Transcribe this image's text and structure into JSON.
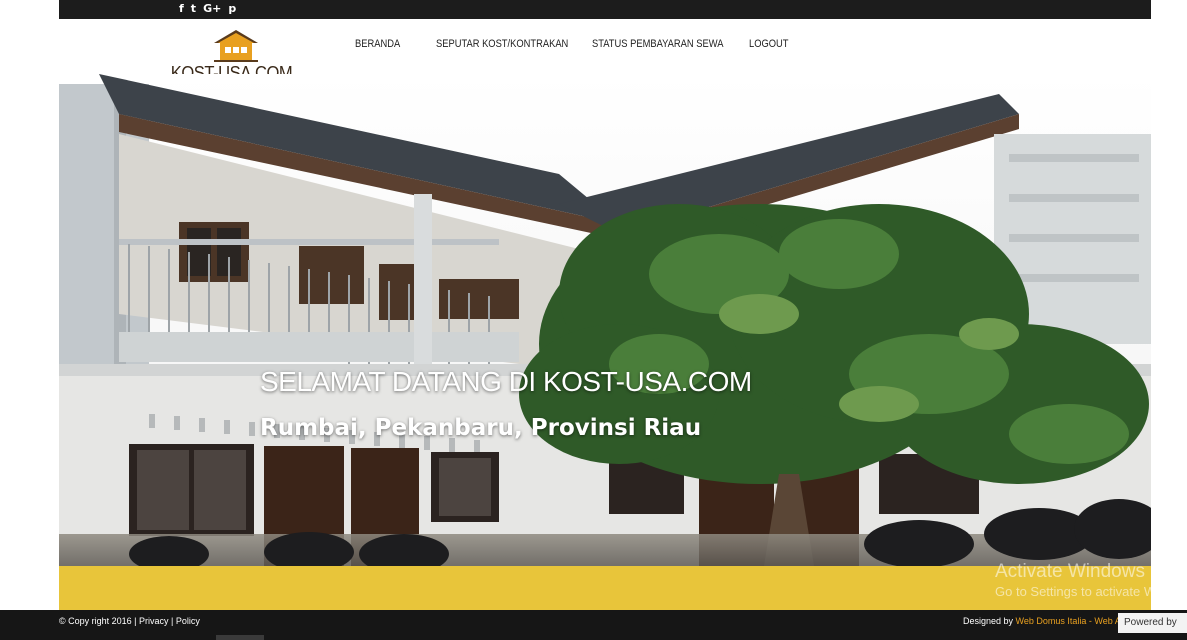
{
  "header": {
    "social_icons": [
      {
        "name": "facebook-icon",
        "glyph": "f"
      },
      {
        "name": "twitter-icon",
        "glyph": "t"
      },
      {
        "name": "google-plus-icon",
        "glyph": "G+"
      },
      {
        "name": "pinterest-icon",
        "glyph": "p"
      }
    ],
    "logo_text": "KOST-USA.COM",
    "nav": [
      {
        "label": "BERANDA"
      },
      {
        "label": "SEPUTAR KOST/KONTRAKAN"
      },
      {
        "label": "STATUS PEMBAYARAN SEWA"
      },
      {
        "label": "LOGOUT"
      }
    ]
  },
  "hero": {
    "title": "SELAMAT DATANG DI KOST-USA.COM",
    "subtitle": "Rumbai, Pekanbaru, Provinsi Riau"
  },
  "watermark": {
    "title": "Activate Windows",
    "subtitle": "Go to Settings to activate Windows."
  },
  "footer": {
    "copyright": "© Copy right 2016 | ",
    "privacy": "Privacy",
    "separator": " | ",
    "policy": "Policy",
    "designed_by": "Designed by ",
    "designer_link": "Web Domus Italia - Web Agency",
    "powered_by": "Powered by"
  },
  "colors": {
    "topbar": "#1c1c1c",
    "accent_band": "#e8c53a",
    "footer": "#161616",
    "link": "#e8a020"
  }
}
